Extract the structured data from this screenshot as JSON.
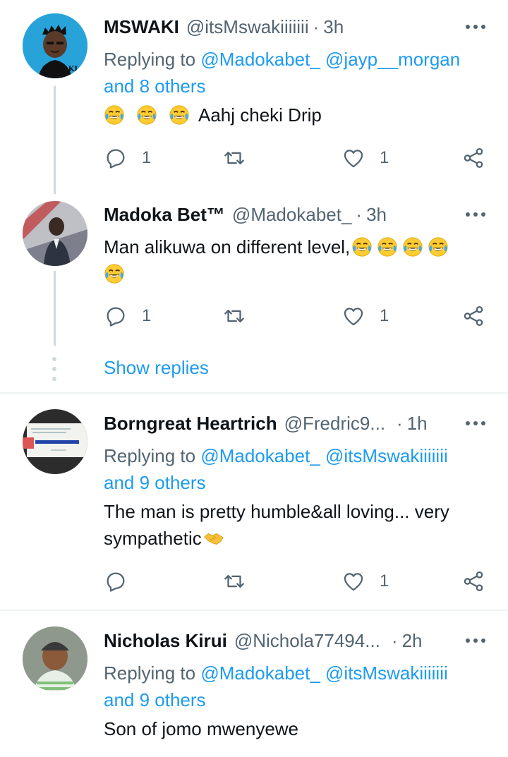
{
  "tweets": [
    {
      "name": "MSWAKI",
      "handle": "@itsMswakiiiiiii",
      "time": "3h",
      "avatar_text": "MSWAKI",
      "replying_prefix": "Replying to",
      "replying_mentions": "@Madokabet_ @jayp__morgan",
      "replying_others": "and 8 others",
      "text": "Aahj cheki Drip",
      "reply_count": "1",
      "like_count": "1"
    },
    {
      "name": "Madoka Bet™",
      "handle": "@Madokabet_",
      "time": "3h",
      "text": "Man alikuwa on different level,",
      "reply_count": "1",
      "like_count": "1",
      "show_replies": "Show replies"
    },
    {
      "name": "Borngreat Heartrich",
      "handle": "@Fredric9...",
      "time": "1h",
      "replying_prefix": "Replying to",
      "replying_mentions": "@Madokabet_ @itsMswakiiiiiii",
      "replying_others": "and 9 others",
      "text_line1": "The man is pretty humble&all loving... very",
      "text_line2": "sympathetic",
      "like_count": "1"
    },
    {
      "name": "Nicholas Kirui",
      "handle": "@Nichola77494...",
      "time": "2h",
      "replying_prefix": "Replying to",
      "replying_mentions": "@Madokabet_ @itsMswakiiiiiii",
      "replying_others": "and 9 others",
      "text": "Son of jomo mwenyewe"
    }
  ],
  "icons": {
    "reply": "reply-icon",
    "retweet": "retweet-icon",
    "like": "heart-icon",
    "share": "share-icon",
    "more": "more-icon",
    "laugh": "tears-of-joy-emoji",
    "handshake": "handshake-emoji"
  },
  "colors": {
    "link": "#1d9bf0",
    "muted": "#536471",
    "text": "#0f1419",
    "divider": "#eff3f4",
    "thread_line": "#cfd9de"
  }
}
